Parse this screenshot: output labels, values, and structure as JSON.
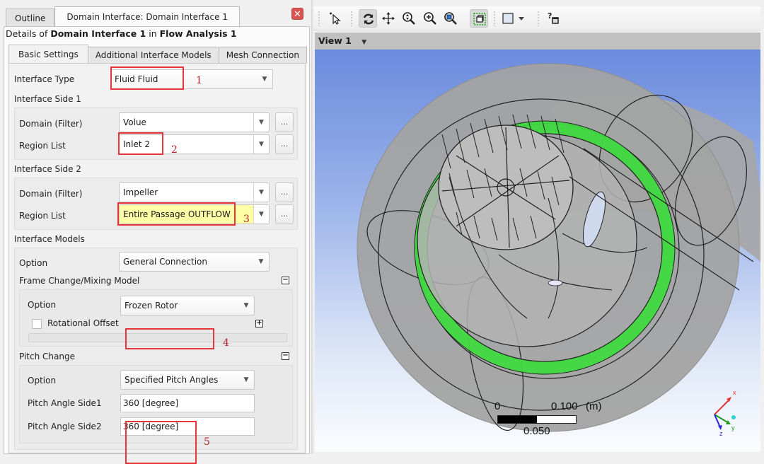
{
  "left_panel": {
    "tabs": [
      {
        "label": "Outline",
        "active": false
      },
      {
        "label": "Domain Interface: Domain Interface 1",
        "active": true
      }
    ],
    "close_icon": "close-icon",
    "details": {
      "prefix": "Details of ",
      "object": "Domain Interface 1",
      "middle": " in ",
      "analysis": "Flow Analysis 1"
    },
    "sub_tabs": [
      {
        "label": "Basic Settings",
        "active": true
      },
      {
        "label": "Additional Interface Models",
        "active": false
      },
      {
        "label": "Mesh Connection",
        "active": false
      }
    ],
    "interface_type": {
      "label": "Interface Type",
      "value": "Fluid Fluid",
      "annotation": "1"
    },
    "side1": {
      "heading": "Interface Side 1",
      "domain": {
        "label": "Domain (Filter)",
        "value": "Volue"
      },
      "region": {
        "label": "Region List",
        "value": "Inlet 2",
        "annotation": "2"
      },
      "browse_label": "..."
    },
    "side2": {
      "heading": "Interface Side 2",
      "domain": {
        "label": "Domain (Filter)",
        "value": "Impeller"
      },
      "region": {
        "label": "Region List",
        "value": "Entire Passage OUTFLOW",
        "annotation": "3"
      },
      "browse_label": "..."
    },
    "models": {
      "heading": "Interface Models",
      "option": {
        "label": "Option",
        "value": "General Connection"
      },
      "frame_change": {
        "heading": "Frame Change/Mixing Model",
        "collapse_glyph": "−",
        "option": {
          "label": "Option",
          "value": "Frozen Rotor",
          "annotation": "4"
        },
        "rotational_offset": {
          "label": "Rotational Offset",
          "checked": false,
          "expand_glyph": "+"
        }
      },
      "pitch_change": {
        "heading": "Pitch Change",
        "collapse_glyph": "−",
        "option": {
          "label": "Option",
          "value": "Specified Pitch Angles"
        },
        "side1": {
          "label": "Pitch Angle Side1",
          "value": "360 [degree]"
        },
        "side2": {
          "label": "Pitch Angle Side2",
          "value": "360 [degree]"
        },
        "annotation": "5"
      }
    },
    "dropdown_glyph": "▼"
  },
  "right_panel": {
    "toolbar": [
      {
        "name": "select-icon",
        "pressed": false
      },
      {
        "name": "rotate-icon",
        "pressed": true
      },
      {
        "name": "pan-icon",
        "pressed": false
      },
      {
        "name": "zoom-icon",
        "pressed": false
      },
      {
        "name": "zoom-in-icon",
        "pressed": false
      },
      {
        "name": "zoom-box-icon",
        "pressed": false
      },
      {
        "name": "fit-view-icon",
        "pressed": true
      },
      {
        "name": "viewport-layout-icon",
        "pressed": false
      },
      {
        "name": "help-icon",
        "pressed": false
      }
    ],
    "view_label": "View 1",
    "dropdown_glyph": "▼",
    "scale_bar": {
      "start": "0",
      "end": "0.100",
      "unit": "(m)",
      "mid": "0.050",
      "filled_fraction": 0.5
    },
    "axes": {
      "x": "x",
      "y": "y",
      "z": "z"
    },
    "colors": {
      "interface_highlight": "#3fd93f",
      "geometry": "#9a9a9a",
      "annotation_box": "#e8343b",
      "region_highlight": "#ffffa6"
    }
  }
}
